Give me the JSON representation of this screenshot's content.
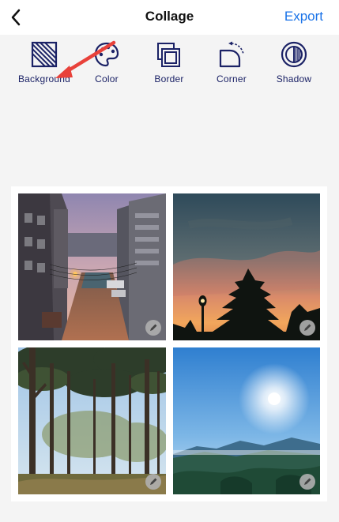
{
  "header": {
    "title": "Collage",
    "export_label": "Export",
    "accent_color": "#1a73e8",
    "back_icon": "chevron-left-icon"
  },
  "toolbar": {
    "tools": [
      {
        "label": "Background",
        "icon": "background-hatch-icon"
      },
      {
        "label": "Color",
        "icon": "palette-icon"
      },
      {
        "label": "Border",
        "icon": "border-icon"
      },
      {
        "label": "Corner",
        "icon": "corner-rotate-icon"
      },
      {
        "label": "Shadow",
        "icon": "shadow-icon"
      }
    ],
    "icon_color": "#1b2266",
    "pointer_color": "#e8413a"
  },
  "collage": {
    "cells": [
      {
        "photo": "city-street-at-dusk",
        "edit_icon": "pencil-icon"
      },
      {
        "photo": "pine-tree-silhouette-sunset",
        "edit_icon": "pencil-icon"
      },
      {
        "photo": "pine-forest",
        "edit_icon": "pencil-icon"
      },
      {
        "photo": "sunny-mountain-range",
        "edit_icon": "pencil-icon"
      }
    ]
  }
}
